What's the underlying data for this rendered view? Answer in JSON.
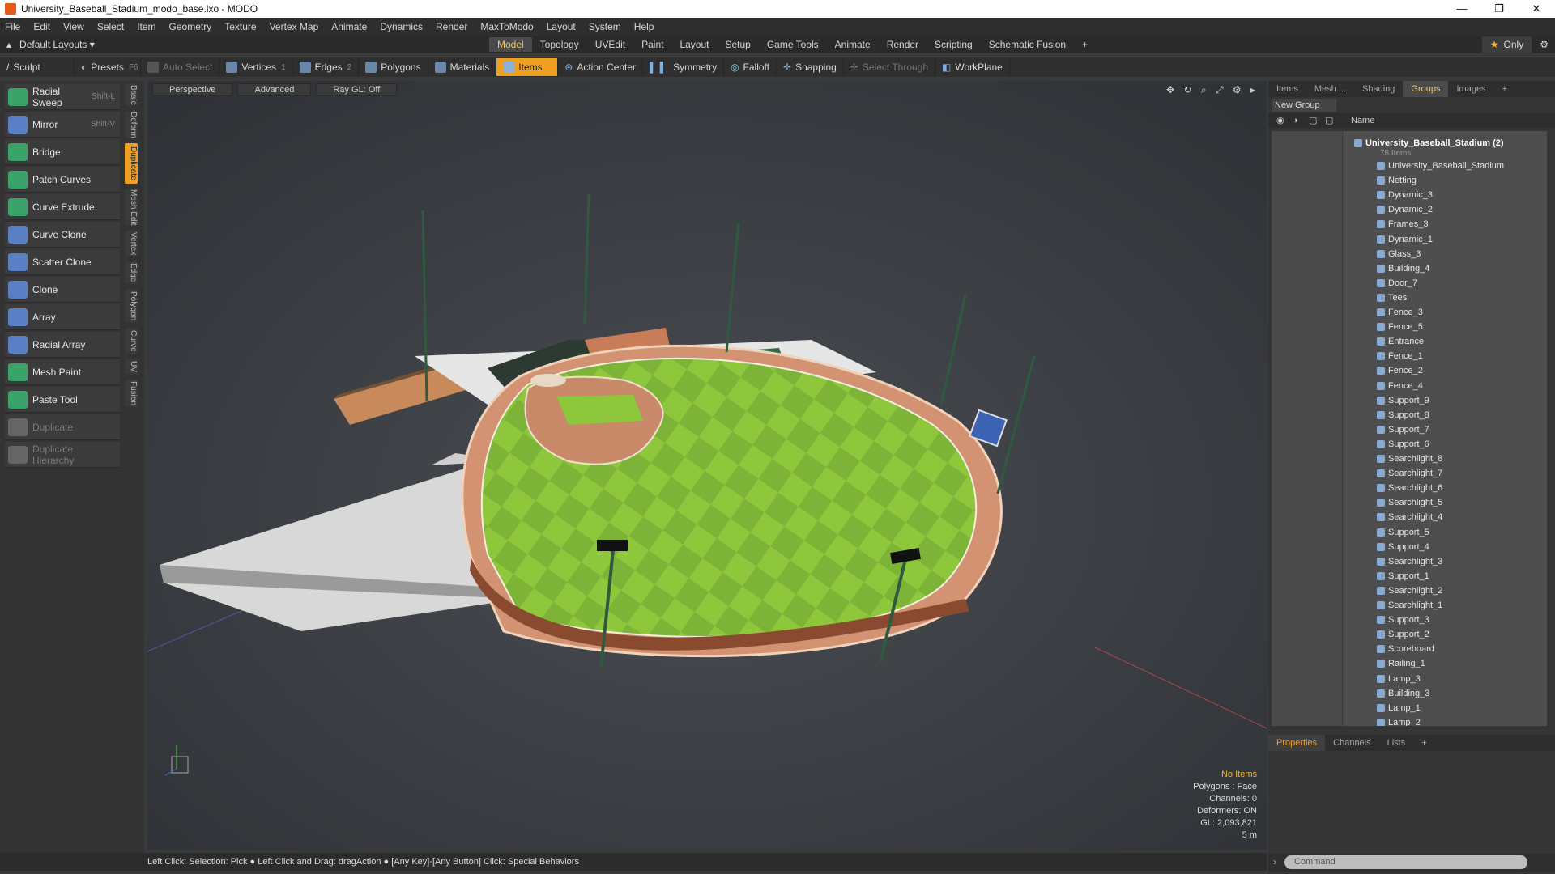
{
  "window": {
    "title": "University_Baseball_Stadium_modo_base.lxo - MODO",
    "minimize": "—",
    "maximize": "❐",
    "close": "✕"
  },
  "menu": [
    "File",
    "Edit",
    "View",
    "Select",
    "Item",
    "Geometry",
    "Texture",
    "Vertex Map",
    "Animate",
    "Dynamics",
    "Render",
    "MaxToModo",
    "Layout",
    "System",
    "Help"
  ],
  "layout": {
    "selector": "Default Layouts ▾",
    "tabs": [
      "Model",
      "Topology",
      "UVEdit",
      "Paint",
      "Layout",
      "Setup",
      "Game Tools",
      "Animate",
      "Render",
      "Scripting",
      "Schematic Fusion",
      "+"
    ],
    "active_tab": "Model",
    "only_label": "Only"
  },
  "toolbar": {
    "sculpt": "Sculpt",
    "presets": "Presets",
    "presets_key": "F6",
    "auto_select": "Auto Select",
    "vertices": "Vertices",
    "vertices_key": "1",
    "edges": "Edges",
    "edges_key": "2",
    "polygons": "Polygons",
    "materials": "Materials",
    "items": "Items",
    "action_center": "Action Center",
    "symmetry": "Symmetry",
    "falloff": "Falloff",
    "snapping": "Snapping",
    "select_through": "Select Through",
    "workplane": "WorkPlane"
  },
  "tools": [
    {
      "label": "Radial Sweep",
      "shortcut": "Shift-L",
      "color": "#3aa36a",
      "enabled": true
    },
    {
      "label": "Mirror",
      "shortcut": "Shift-V",
      "color": "#5a7fc4",
      "enabled": true
    },
    {
      "label": "Bridge",
      "shortcut": "",
      "color": "#3aa36a",
      "enabled": true
    },
    {
      "label": "Patch Curves",
      "shortcut": "",
      "color": "#3aa36a",
      "enabled": true
    },
    {
      "label": "Curve Extrude",
      "shortcut": "",
      "color": "#3aa36a",
      "enabled": true
    },
    {
      "label": "Curve Clone",
      "shortcut": "",
      "color": "#5a7fc4",
      "enabled": true
    },
    {
      "label": "Scatter Clone",
      "shortcut": "",
      "color": "#5a7fc4",
      "enabled": true
    },
    {
      "label": "Clone",
      "shortcut": "",
      "color": "#5a7fc4",
      "enabled": true
    },
    {
      "label": "Array",
      "shortcut": "",
      "color": "#5a7fc4",
      "enabled": true
    },
    {
      "label": "Radial Array",
      "shortcut": "",
      "color": "#5a7fc4",
      "enabled": true
    },
    {
      "label": "Mesh Paint",
      "shortcut": "",
      "color": "#3aa36a",
      "enabled": true
    },
    {
      "label": "Paste Tool",
      "shortcut": "",
      "color": "#3aa36a",
      "enabled": true
    },
    {
      "label": "Duplicate",
      "shortcut": "",
      "color": "#666666",
      "enabled": false
    },
    {
      "label": "Duplicate Hierarchy",
      "shortcut": "",
      "color": "#666666",
      "enabled": false
    }
  ],
  "side_tabs": [
    "Basic",
    "Deform",
    "Duplicate",
    "Mesh Edit",
    "Vertex",
    "Edge",
    "Polygon",
    "Curve",
    "UV",
    "Fusion"
  ],
  "side_tab_active": "Duplicate",
  "viewport": {
    "view": "Perspective",
    "mode": "Advanced",
    "raygl": "Ray GL: Off",
    "icons": "✥ ↻ ⌕ ⤢ ⚙ ▸",
    "info": {
      "selection": "No Items",
      "polygons": "Polygons : Face",
      "channels": "Channels: 0",
      "deformers": "Deformers: ON",
      "gl": "GL: 2,093,821",
      "scale": "5 m"
    }
  },
  "status": "Left Click: Selection: Pick ● Left Click and Drag: dragAction ● [Any Key]-[Any Button] Click: Special Behaviors",
  "right_panel": {
    "tabs": [
      "Items",
      "Mesh ...",
      "Shading",
      "Groups",
      "Images",
      "+"
    ],
    "active_tab": "Groups",
    "new_group": "New Group",
    "name_header": "Name",
    "root": "University_Baseball_Stadium",
    "root_count": "(2)",
    "root_sub": "78 Items",
    "items": [
      "University_Baseball_Stadium",
      "Netting",
      "Dynamic_3",
      "Dynamic_2",
      "Frames_3",
      "Dynamic_1",
      "Glass_3",
      "Building_4",
      "Door_7",
      "Tees",
      "Fence_3",
      "Fence_5",
      "Entrance",
      "Fence_1",
      "Fence_2",
      "Fence_4",
      "Support_9",
      "Support_8",
      "Support_7",
      "Support_6",
      "Searchlight_8",
      "Searchlight_7",
      "Searchlight_6",
      "Searchlight_5",
      "Searchlight_4",
      "Support_5",
      "Support_4",
      "Searchlight_3",
      "Support_1",
      "Searchlight_2",
      "Searchlight_1",
      "Support_3",
      "Support_2",
      "Scoreboard",
      "Railing_1",
      "Lamp_3",
      "Building_3",
      "Lamp_1",
      "Lamp_2"
    ]
  },
  "properties": {
    "tabs": [
      "Properties",
      "Channels",
      "Lists",
      "+"
    ],
    "active_tab": "Properties"
  },
  "command": {
    "placeholder": "Command"
  }
}
